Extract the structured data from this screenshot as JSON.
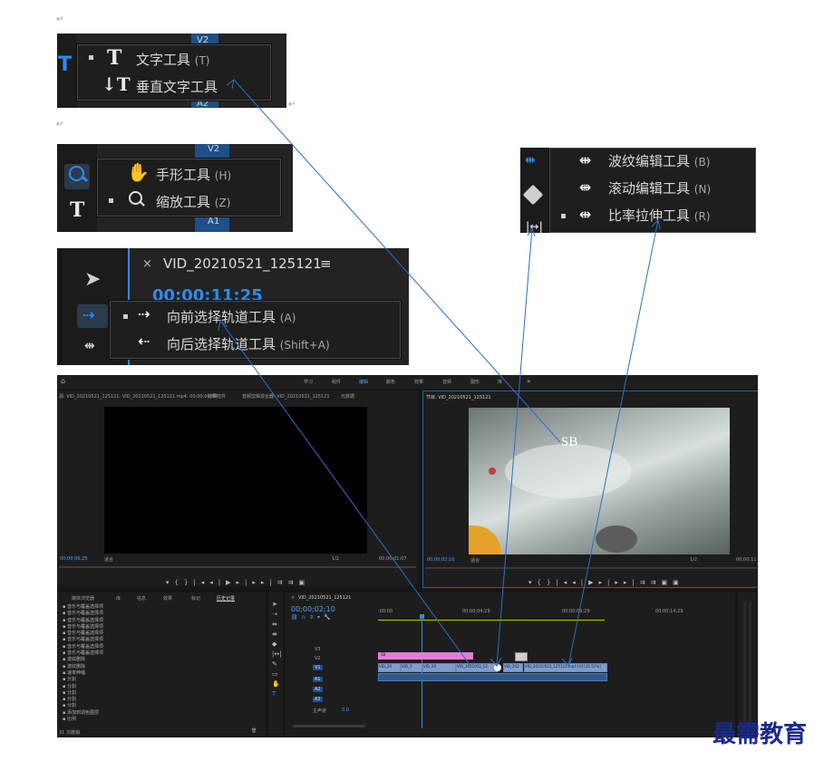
{
  "para_mark": "↵",
  "crop1": {
    "items": [
      {
        "label": "文字工具",
        "key": "(T)",
        "selected": true
      },
      {
        "label": "垂直文字工具",
        "key": "",
        "selected": false
      }
    ],
    "track_label_top": "V2",
    "track_label_bottom": "A2"
  },
  "crop2": {
    "items": [
      {
        "label": "手形工具",
        "key": "(H)",
        "selected": false
      },
      {
        "label": "缩放工具",
        "key": "(Z)",
        "selected": true
      }
    ],
    "track_label_top": "V2",
    "track_label_bottom": "A1"
  },
  "crop3": {
    "sequence_title": "VID_20210521_125121",
    "timecode": "00;00;11;25",
    "items": [
      {
        "label": "向前选择轨道工具",
        "key": "(A)",
        "selected": true
      },
      {
        "label": "向后选择轨道工具",
        "key": "(Shift+A)",
        "selected": false
      }
    ]
  },
  "crop4": {
    "items": [
      {
        "label": "波纹编辑工具",
        "key": "(B)",
        "selected": false
      },
      {
        "label": "滚动编辑工具",
        "key": "(N)",
        "selected": false
      },
      {
        "label": "比率拉伸工具",
        "key": "(R)",
        "selected": true
      }
    ]
  },
  "app": {
    "workspaces": [
      "学习",
      "组件",
      "编辑",
      "颜色",
      "效果",
      "音频",
      "图形",
      "库"
    ],
    "active_workspace": "编辑",
    "source_tabs": [
      "源: VID_20210521_125121: VID_20210521_125121.mp4: 00;00;00;00",
      "效果控件",
      "音频剪辑混合器: VID_20210521_125121",
      "元数据"
    ],
    "program_title": "节目: VID_20210521_125121",
    "watermark_text": "SB",
    "source_time_left": "00;00;06;25",
    "source_fit": "适合",
    "source_zoom": "1/2",
    "source_time_right": "00;00;01;07",
    "program_time_left": "00;00;02;10",
    "program_fit": "适合",
    "program_zoom": "1/2",
    "program_time_right": "00;00;11",
    "project_tabs": [
      "媒体浏览器",
      "库",
      "信息",
      "效果",
      "标记",
      "历史记录"
    ],
    "history_items": [
      "音乐与覆盖选择项",
      "音乐与覆盖选择项",
      "音乐与覆盖选择项",
      "音乐与覆盖选择项",
      "音乐与覆盖选择项",
      "音乐与覆盖选择项",
      "音乐与覆盖选择项",
      "音乐与覆盖选择项",
      "波纹删除",
      "波纹删除",
      "速率伸缩",
      "分割",
      "分割",
      "分割",
      "分割",
      "分割",
      "添加到调色图层",
      "比例"
    ],
    "history_footer": "31 次撤销",
    "timeline_title": "VID_20210521_125121",
    "timeline_time": "00;00;02;10",
    "ruler_labels": [
      ":00;00",
      "00;00;04;29",
      "00;00;09;29",
      "00;00;14;29"
    ],
    "tracks": [
      "V3",
      "V2",
      "V1",
      "A1",
      "A2",
      "A3"
    ],
    "master_label": "主声道",
    "master_value": "0.0",
    "clip_labels": [
      "VID_20",
      "VID_2",
      "VID_20",
      "VID_2021052_12",
      "VID_202",
      "VID_20210521_125121.mp4 [V] [45.51%]"
    ],
    "pink_clip_label": "SB"
  },
  "brand": "最需教育",
  "colors": {
    "accent": "#2d8ceb",
    "clip_blue": "#7f9ccc",
    "pink_clip": "#e27dd8",
    "brand_text": "#1a2a8a",
    "arrow": "#2e6fc0"
  }
}
